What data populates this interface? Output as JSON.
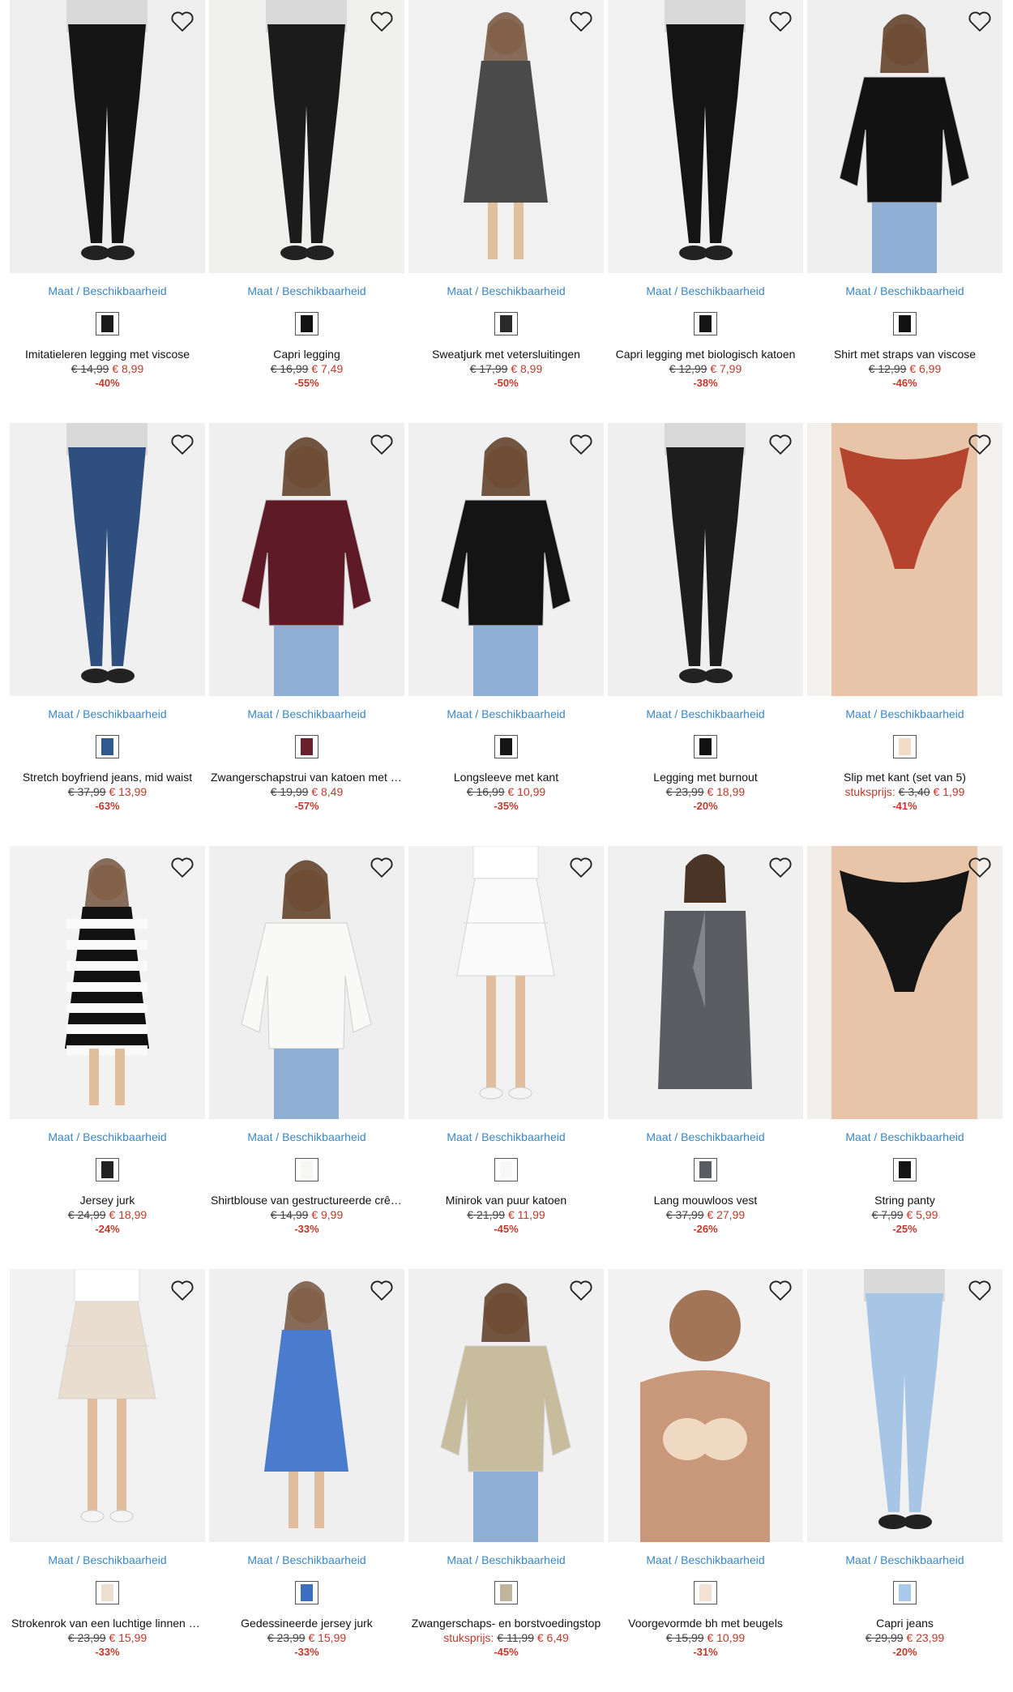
{
  "availability_label": "Maat / Beschikbaarheid",
  "favorite_icon": "heart-outline-icon",
  "products": [
    {
      "name": "Imitatieleren legging met viscose",
      "unit_label": "",
      "old_price": "€ 14,99",
      "new_price": "€ 8,99",
      "discount": "-40%",
      "swatch": "#1a1a1a",
      "img_bg": "#eeeeee",
      "fig": "legging",
      "fig_color": "#151515"
    },
    {
      "name": "Capri legging",
      "unit_label": "",
      "old_price": "€ 16,99",
      "new_price": "€ 7,49",
      "discount": "-55%",
      "swatch": "#111111",
      "img_bg": "#f0f0ee",
      "fig": "legging",
      "fig_color": "#1b1b1b"
    },
    {
      "name": "Sweatjurk met vetersluitingen",
      "unit_label": "",
      "old_price": "€ 17,99",
      "new_price": "€ 8,99",
      "discount": "-50%",
      "swatch": "#2a2a2a",
      "img_bg": "#f1f1f1",
      "fig": "dress",
      "fig_color": "#4a4a4a"
    },
    {
      "name": "Capri legging met biologisch katoen",
      "unit_label": "",
      "old_price": "€ 12,99",
      "new_price": "€ 7,99",
      "discount": "-38%",
      "swatch": "#151515",
      "img_bg": "#f1f1f1",
      "fig": "legging",
      "fig_color": "#141414"
    },
    {
      "name": "Shirt met straps van viscose",
      "unit_label": "",
      "old_price": "€ 12,99",
      "new_price": "€ 6,99",
      "discount": "-46%",
      "swatch": "#111111",
      "img_bg": "#efefef",
      "fig": "top",
      "fig_color": "#121212"
    },
    {
      "name": "Stretch boyfriend jeans, mid waist",
      "unit_label": "",
      "old_price": "€ 37,99",
      "new_price": "€ 13,99",
      "discount": "-63%",
      "swatch": "#2f5a8f",
      "img_bg": "#f0f0f0",
      "fig": "legging",
      "fig_color": "#2f4f7f"
    },
    {
      "name": "Zwangerschapstrui van katoen met strikband",
      "unit_label": "",
      "old_price": "€ 19,99",
      "new_price": "€ 8,49",
      "discount": "-57%",
      "swatch": "#6b1e2c",
      "img_bg": "#efefef",
      "fig": "top",
      "fig_color": "#5e1a27"
    },
    {
      "name": "Longsleeve met kant",
      "unit_label": "",
      "old_price": "€ 16,99",
      "new_price": "€ 10,99",
      "discount": "-35%",
      "swatch": "#151515",
      "img_bg": "#f0f0f0",
      "fig": "top",
      "fig_color": "#141414"
    },
    {
      "name": "Legging met burnout",
      "unit_label": "",
      "old_price": "€ 23,99",
      "new_price": "€ 18,99",
      "discount": "-20%",
      "swatch": "#111111",
      "img_bg": "#efefef",
      "fig": "legging",
      "fig_color": "#1d1d1d"
    },
    {
      "name": "Slip met kant (set van 5)",
      "unit_label": "stuksprijs: ",
      "old_price": "€ 3,40",
      "new_price": "€ 1,99",
      "discount": "-41%",
      "swatch": "#f2dcc8",
      "img_bg": "#f3f1ee",
      "fig": "brief",
      "fig_color": "#b5442e"
    },
    {
      "name": "Jersey jurk",
      "unit_label": "",
      "old_price": "€ 24,99",
      "new_price": "€ 18,99",
      "discount": "-24%",
      "swatch": "#222222",
      "img_bg": "#f2f2f2",
      "fig": "dress-stripe",
      "fig_color": "#111111"
    },
    {
      "name": "Shirtblouse van gestructureerde crêpe",
      "unit_label": "",
      "old_price": "€ 14,99",
      "new_price": "€ 9,99",
      "discount": "-33%",
      "swatch": "#f6f6f4",
      "img_bg": "#efefef",
      "fig": "top",
      "fig_color": "#f9f9f7"
    },
    {
      "name": "Minirok van puur katoen",
      "unit_label": "",
      "old_price": "€ 21,99",
      "new_price": "€ 11,99",
      "discount": "-45%",
      "swatch": "#f8f8f8",
      "img_bg": "#f1f1f1",
      "fig": "skirt",
      "fig_color": "#fafafa"
    },
    {
      "name": "Lang mouwloos vest",
      "unit_label": "",
      "old_price": "€ 37,99",
      "new_price": "€ 27,99",
      "discount": "-26%",
      "swatch": "#5a5c62",
      "img_bg": "#f0f0f0",
      "fig": "vest",
      "fig_color": "#5b5d63"
    },
    {
      "name": "String panty",
      "unit_label": "",
      "old_price": "€ 7,99",
      "new_price": "€ 5,99",
      "discount": "-25%",
      "swatch": "#141414",
      "img_bg": "#f2f0ed",
      "fig": "brief",
      "fig_color": "#151515"
    },
    {
      "name": "Strokenrok van een luchtige linnen mix",
      "unit_label": "",
      "old_price": "€ 23,99",
      "new_price": "€ 15,99",
      "discount": "-33%",
      "swatch": "#ecdfd2",
      "img_bg": "#f1f1f1",
      "fig": "skirt",
      "fig_color": "#e9ddd0"
    },
    {
      "name": "Gedessineerde jersey jurk",
      "unit_label": "",
      "old_price": "€ 23,99",
      "new_price": "€ 15,99",
      "discount": "-33%",
      "swatch": "#3c6fc0",
      "img_bg": "#efefef",
      "fig": "dress",
      "fig_color": "#4a7bcc"
    },
    {
      "name": "Zwangerschaps- en borstvoedingstop",
      "unit_label": "stuksprijs: ",
      "old_price": "€ 11,99",
      "new_price": "€ 6,49",
      "discount": "-45%",
      "swatch": "#bfb59a",
      "img_bg": "#f0f0f0",
      "fig": "top",
      "fig_color": "#c7bc9c"
    },
    {
      "name": "Voorgevormde bh met beugels",
      "unit_label": "",
      "old_price": "€ 15,99",
      "new_price": "€ 10,99",
      "discount": "-31%",
      "swatch": "#f3e3d3",
      "img_bg": "#f2f2f2",
      "fig": "bra",
      "fig_color": "#f0d9c2"
    },
    {
      "name": "Capri jeans",
      "unit_label": "",
      "old_price": "€ 29,99",
      "new_price": "€ 23,99",
      "discount": "-20%",
      "swatch": "#a9c9ea",
      "img_bg": "#f1f1f1",
      "fig": "legging",
      "fig_color": "#a7c6e6"
    }
  ]
}
